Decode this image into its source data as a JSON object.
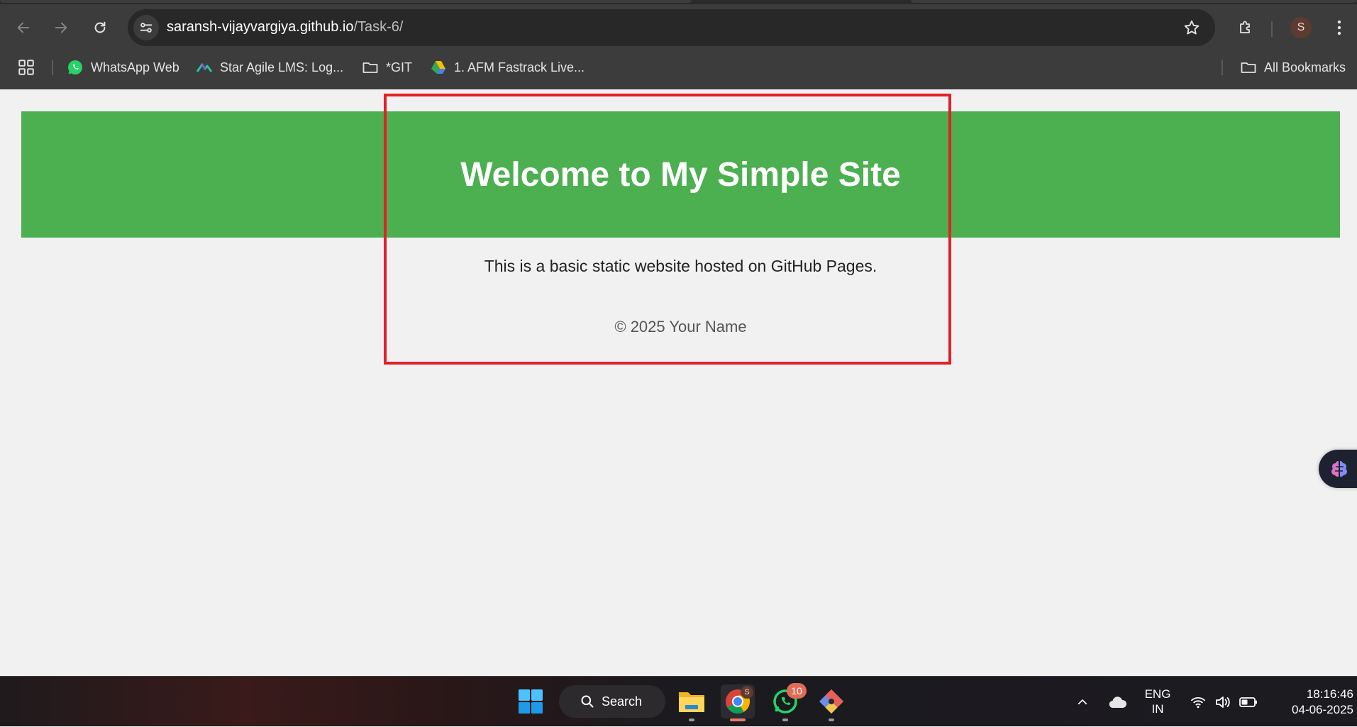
{
  "browser": {
    "url_host": "saransh-vijayvargiya.github.io",
    "url_path": "/Task-6/",
    "profile_initial": "S",
    "bookmarks": [
      {
        "label": "WhatsApp Web",
        "icon": "whatsapp-icon"
      },
      {
        "label": "Star Agile LMS: Log...",
        "icon": "star-agile-icon"
      },
      {
        "label": "*GIT",
        "icon": "folder-icon"
      },
      {
        "label": "1. AFM Fastrack Live...",
        "icon": "google-drive-icon"
      }
    ],
    "all_bookmarks_label": "All Bookmarks"
  },
  "site": {
    "title": "Welcome to My Simple Site",
    "text": "This is a basic static website hosted on GitHub Pages.",
    "footer": "© 2025 Your Name",
    "header_color": "#4caf50",
    "highlight_color": "#e3202a"
  },
  "taskbar": {
    "search_label": "Search",
    "chrome_badge": "S",
    "whatsapp_badge": "10",
    "lang_line1": "ENG",
    "lang_line2": "IN",
    "time": "18:16:46",
    "date": "04-06-2025"
  }
}
